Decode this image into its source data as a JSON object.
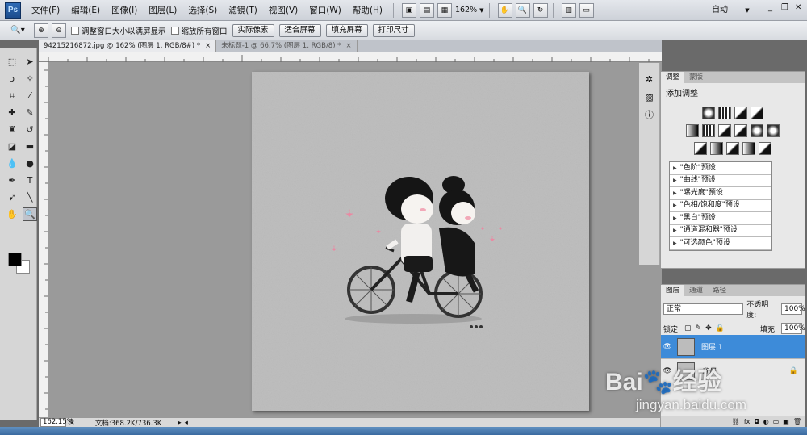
{
  "menubar": {
    "logo": "Ps",
    "items": [
      "文件(F)",
      "编辑(E)",
      "图像(I)",
      "图层(L)",
      "选择(S)",
      "滤镜(T)",
      "视图(V)",
      "窗口(W)",
      "帮助(H)"
    ],
    "zoom": "162%",
    "workspace": "自动"
  },
  "options": {
    "check1": "调整窗口大小以满屏显示",
    "check2": "缩放所有窗口",
    "btn_actual": "实际像素",
    "btn_fit": "适合屏幕",
    "btn_fill": "填充屏幕",
    "btn_print": "打印尺寸"
  },
  "tabs": [
    {
      "label": "94215216872.jpg @ 162% (图层 1, RGB/8#) *",
      "close": "×"
    },
    {
      "label": "未标题-1 @ 66.7% (图层 1, RGB/8) *",
      "close": "×"
    }
  ],
  "status": {
    "zoom": "162.15%",
    "doc": "文档:368.2K/736.3K"
  },
  "adjust_panel": {
    "tab1": "调整",
    "tab2": "蒙版",
    "title": "添加调整",
    "presets": [
      "\"色阶\"预设",
      "\"曲线\"预设",
      "\"曝光度\"预设",
      "\"色相/饱和度\"预设",
      "\"黑白\"预设",
      "\"通道混和器\"预设",
      "\"可选颜色\"预设"
    ]
  },
  "layers_panel": {
    "tab1": "图层",
    "tab2": "通道",
    "tab3": "路径",
    "blend_mode": "正常",
    "opacity_label": "不透明度:",
    "opacity_value": "100%",
    "lock_label": "锁定:",
    "fill_label": "填充:",
    "fill_value": "100%",
    "layers": [
      {
        "name": "图层 1",
        "active": true
      },
      {
        "name": "背景",
        "active": false
      }
    ]
  },
  "watermark": {
    "main": "Bai🐾经验",
    "url": "jingyan.baidu.com"
  }
}
